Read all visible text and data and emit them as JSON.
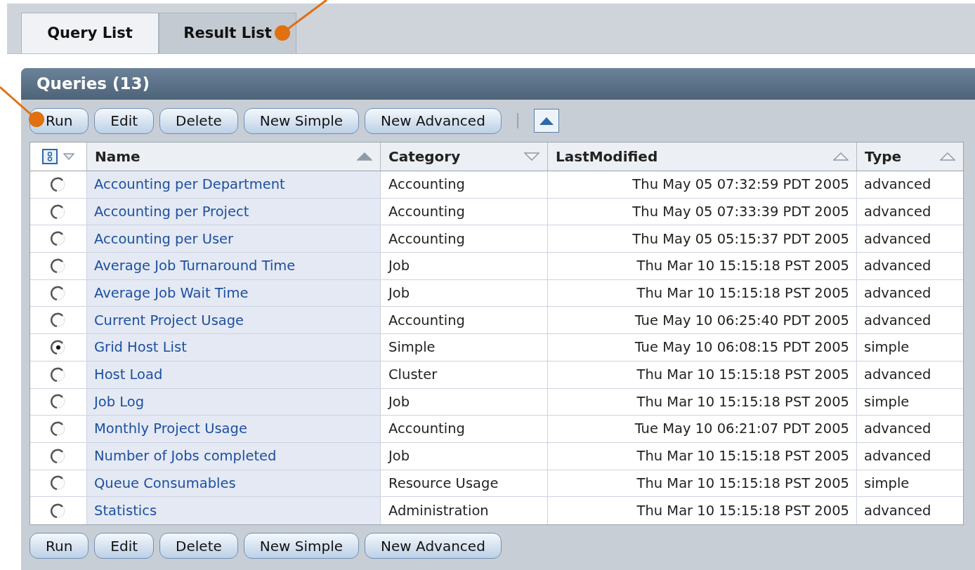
{
  "tabs": [
    {
      "label": "Query List",
      "selected": true
    },
    {
      "label": "Result List",
      "selected": false
    }
  ],
  "panel": {
    "title": "Queries (13)",
    "top_buttons": [
      "Run",
      "Edit",
      "Delete",
      "New Simple",
      "New Advanced"
    ],
    "bottom_buttons": [
      "Run",
      "Edit",
      "Delete",
      "New Simple",
      "New Advanced"
    ]
  },
  "table": {
    "columns": [
      {
        "label": "Name",
        "descending": false,
        "active": true
      },
      {
        "label": "Category",
        "descending": true,
        "active": false
      },
      {
        "label": "LastModified",
        "descending": false,
        "active": false
      },
      {
        "label": "Type",
        "descending": false,
        "active": false
      }
    ],
    "rows": [
      {
        "name": "Accounting per Department",
        "category": "Accounting",
        "last_modified": "Thu May 05 07:32:59 PDT 2005",
        "type": "advanced",
        "selected": false
      },
      {
        "name": "Accounting per Project",
        "category": "Accounting",
        "last_modified": "Thu May 05 07:33:39 PDT 2005",
        "type": "advanced",
        "selected": false
      },
      {
        "name": "Accounting per User",
        "category": "Accounting",
        "last_modified": "Thu May 05 05:15:37 PDT 2005",
        "type": "advanced",
        "selected": false
      },
      {
        "name": "Average Job Turnaround Time",
        "category": "Job",
        "last_modified": "Thu Mar 10 15:15:18 PST 2005",
        "type": "advanced",
        "selected": false
      },
      {
        "name": "Average Job Wait Time",
        "category": "Job",
        "last_modified": "Thu Mar 10 15:15:18 PST 2005",
        "type": "advanced",
        "selected": false
      },
      {
        "name": "Current Project Usage",
        "category": "Accounting",
        "last_modified": "Tue May 10 06:25:40 PDT 2005",
        "type": "advanced",
        "selected": false
      },
      {
        "name": "Grid Host List",
        "category": "Simple",
        "last_modified": "Tue May 10 06:08:15 PDT 2005",
        "type": "simple",
        "selected": true
      },
      {
        "name": "Host Load",
        "category": "Cluster",
        "last_modified": "Thu Mar 10 15:15:18 PST 2005",
        "type": "advanced",
        "selected": false
      },
      {
        "name": "Job Log",
        "category": "Job",
        "last_modified": "Thu Mar 10 15:15:18 PST 2005",
        "type": "simple",
        "selected": false
      },
      {
        "name": "Monthly Project Usage",
        "category": "Accounting",
        "last_modified": "Tue May 10 06:21:07 PDT 2005",
        "type": "advanced",
        "selected": false
      },
      {
        "name": "Number of Jobs completed",
        "category": "Job",
        "last_modified": "Thu Mar 10 15:15:18 PST 2005",
        "type": "advanced",
        "selected": false
      },
      {
        "name": "Queue Consumables",
        "category": "Resource Usage",
        "last_modified": "Thu Mar 10 15:15:18 PST 2005",
        "type": "simple",
        "selected": false
      },
      {
        "name": "Statistics",
        "category": "Administration",
        "last_modified": "Thu Mar 10 15:15:18 PST 2005",
        "type": "advanced",
        "selected": false
      }
    ]
  }
}
